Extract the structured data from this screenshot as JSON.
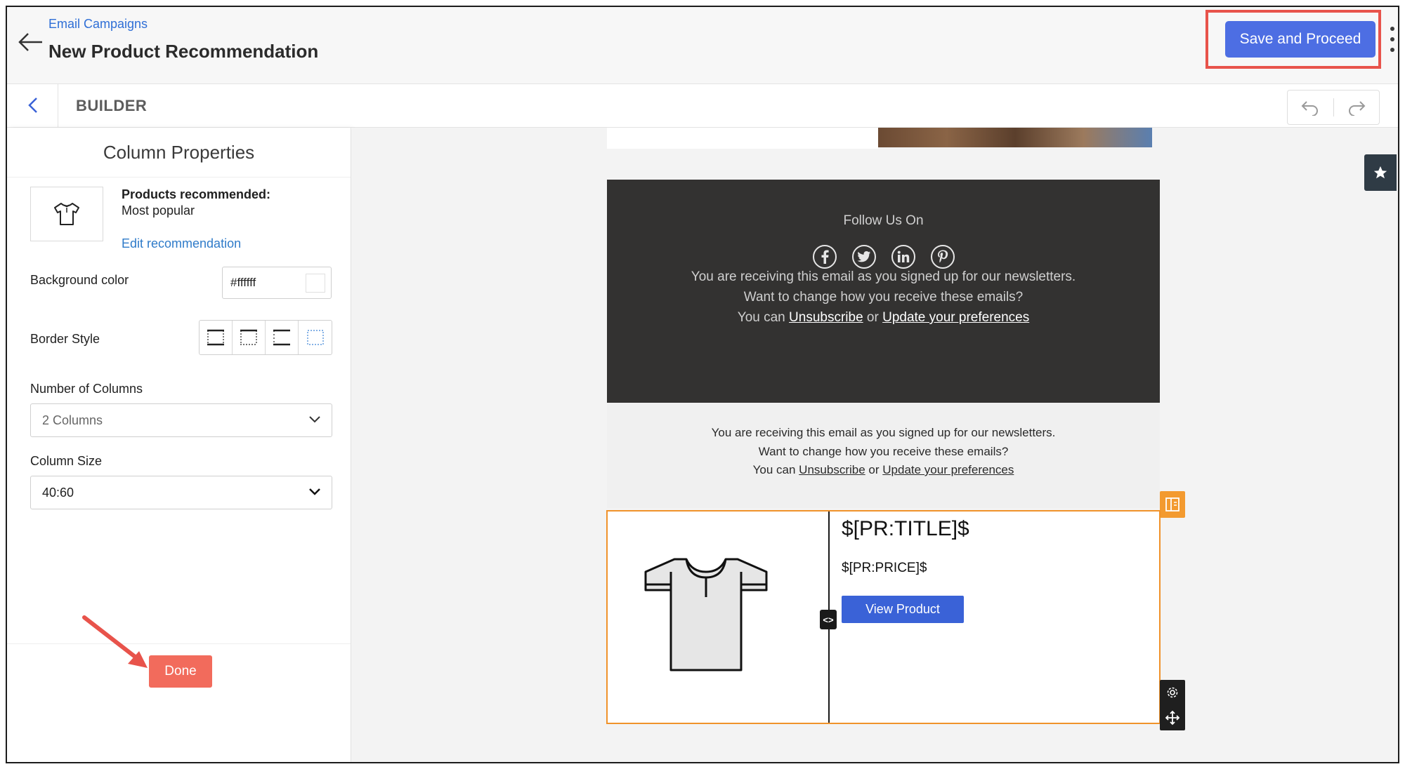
{
  "header": {
    "breadcrumb": "Email Campaigns",
    "title": "New Product Recommendation",
    "save_label": "Save and Proceed"
  },
  "builder": {
    "label": "BUILDER"
  },
  "panel": {
    "title": "Column Properties",
    "rec_heading": "Products recommended:",
    "rec_value": "Most popular",
    "edit_link": "Edit recommendation",
    "bg_label": "Background color",
    "bg_value": "#ffffff",
    "border_label": "Border Style",
    "columns_label": "Number of Columns",
    "columns_value": "2 Columns",
    "size_label": "Column Size",
    "size_value": "40:60",
    "done_label": "Done"
  },
  "email": {
    "follow_title": "Follow Us On",
    "dark_line1": "You are receiving this email as you signed up for our newsletters.",
    "dark_line2": "Want to change how you receive these emails?",
    "line3_prefix": "You can",
    "unsubscribe": "Unsubscribe",
    "or": "or",
    "update_prefs": "Update your preferences",
    "light_line1": "You are receiving this email as you signed up for our newsletters.",
    "light_line2": "Want to change how you receive these emails?",
    "product_title": "$[PR:TITLE]$",
    "product_price": "$[PR:PRICE]$",
    "view_button": "View Product"
  },
  "colors": {
    "primary": "#4d6ee3",
    "done": "#f26b5c",
    "highlight": "#e8534b",
    "block_border": "#f0922a",
    "footer_dark": "#333231"
  }
}
